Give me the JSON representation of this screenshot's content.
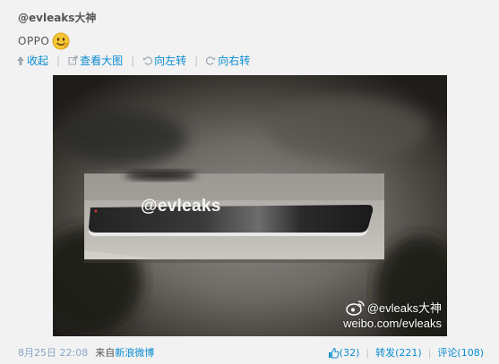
{
  "post": {
    "author": "@evleaks大神",
    "text": "OPPO",
    "emoji": "grin-emoji"
  },
  "toolbar": {
    "collapse": "收起",
    "view_large": "查看大图",
    "rotate_left": "向左转",
    "rotate_right": "向右转"
  },
  "image": {
    "phone_overlay": "@evleaks",
    "watermark_user": "@evleaks大神",
    "watermark_url": "weibo.com/evleaks"
  },
  "footer": {
    "timestamp": "8月25日 22:08",
    "from_label": "来自",
    "source": "新浪微博",
    "like_count": "(32)",
    "repost": "转发(221)",
    "comment": "评论(108)"
  },
  "colors": {
    "link": "#0a8cd2",
    "background": "#f2f2f2"
  }
}
